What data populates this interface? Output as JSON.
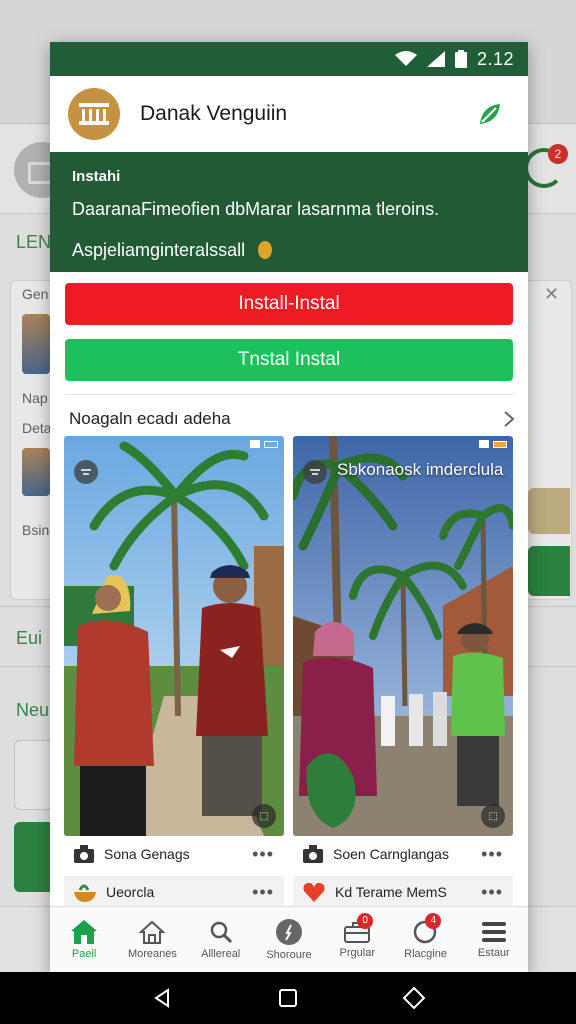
{
  "background": {
    "label_1": "LEN",
    "card_title": "Gen",
    "row_1": "Nap",
    "row_2": "Deta",
    "row_3": "Bsin",
    "label_2": "Eui",
    "label_3": "Neu",
    "badge_count": "2"
  },
  "status_bar": {
    "time": "2.12"
  },
  "app_header": {
    "title": "Danak Venguiin"
  },
  "banner": {
    "heading": "Instahi",
    "line1": "DaaranaFimeofien dbMarar lasarnma tleroins.",
    "line2": "Aspjeliamginteralssall"
  },
  "buttons": {
    "primary_red": "Install-Instal",
    "secondary_green": "Tnstal Instal"
  },
  "section": {
    "title": "Noagaln ecadı adeha"
  },
  "cards": [
    {
      "meta": "Sona Genags",
      "sub": "Ueorcla"
    },
    {
      "caption": "Sbkonaosk imderclula",
      "meta": "Soen Carnglangas",
      "sub": "Kd Terame MemS"
    }
  ],
  "tabs": [
    {
      "label": "Paeil",
      "icon": "home-icon",
      "active": true
    },
    {
      "label": "Moreanes",
      "icon": "house-outline-icon"
    },
    {
      "label": "Alllereal",
      "icon": "search-icon"
    },
    {
      "label": "Shoroure",
      "icon": "compass-icon"
    },
    {
      "label": "Prgular",
      "icon": "briefcase-icon",
      "badge": "0"
    },
    {
      "label": "Rlacgine",
      "icon": "bell-icon",
      "badge": "4"
    },
    {
      "label": "Estaur",
      "icon": "menu-icon"
    }
  ],
  "colors": {
    "brand_dark_green": "#1f5e36",
    "install_red": "#ee1b24",
    "install_green": "#1dc05a",
    "logo_gold": "#c59142"
  }
}
